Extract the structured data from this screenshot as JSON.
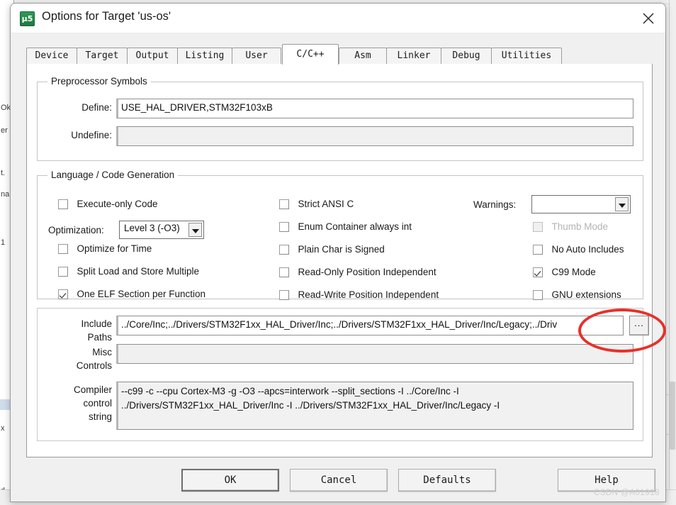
{
  "window": {
    "title": "Options for Target 'us-os'",
    "icon": "uvision-icon",
    "icon_glyph": "µ5",
    "close_label": "✕"
  },
  "tabs": [
    {
      "label": "Device",
      "active": false
    },
    {
      "label": "Target",
      "active": false
    },
    {
      "label": "Output",
      "active": false
    },
    {
      "label": "Listing",
      "active": false
    },
    {
      "label": "User",
      "active": false
    },
    {
      "label": "C/C++",
      "active": true
    },
    {
      "label": "Asm",
      "active": false
    },
    {
      "label": "Linker",
      "active": false
    },
    {
      "label": "Debug",
      "active": false
    },
    {
      "label": "Utilities",
      "active": false
    }
  ],
  "preprocessor": {
    "legend": "Preprocessor Symbols",
    "define_label": "Define:",
    "define_value": "USE_HAL_DRIVER,STM32F103xB",
    "undefine_label": "Undefine:",
    "undefine_value": ""
  },
  "language": {
    "legend": "Language / Code Generation",
    "optimization_label": "Optimization:",
    "optimization_value": "Level 3 (-O3)",
    "warnings_label": "Warnings:",
    "warnings_value": "",
    "column1": [
      {
        "label": "Execute-only Code",
        "checked": false,
        "disabled": false
      },
      {
        "label": "Optimize for Time",
        "checked": false,
        "disabled": false
      },
      {
        "label": "Split Load and Store Multiple",
        "checked": false,
        "disabled": false
      },
      {
        "label": "One ELF Section per Function",
        "checked": true,
        "disabled": false
      }
    ],
    "column2": [
      {
        "label": "Strict ANSI C",
        "checked": false,
        "disabled": false
      },
      {
        "label": "Enum Container always int",
        "checked": false,
        "disabled": false
      },
      {
        "label": "Plain Char is Signed",
        "checked": false,
        "disabled": false
      },
      {
        "label": "Read-Only Position Independent",
        "checked": false,
        "disabled": false
      },
      {
        "label": "Read-Write Position Independent",
        "checked": false,
        "disabled": false
      }
    ],
    "column3": [
      {
        "label": "Thumb Mode",
        "checked": false,
        "disabled": true
      },
      {
        "label": "No Auto Includes",
        "checked": false,
        "disabled": false
      },
      {
        "label": "C99 Mode",
        "checked": true,
        "disabled": false
      },
      {
        "label": "GNU extensions",
        "checked": false,
        "disabled": false
      }
    ]
  },
  "paths": {
    "include_label_line1": "Include",
    "include_label_line2": "Paths",
    "include_value": "../Core/Inc;../Drivers/STM32F1xx_HAL_Driver/Inc;../Drivers/STM32F1xx_HAL_Driver/Inc/Legacy;../Driv",
    "browse_label": "...",
    "misc_label_line1": "Misc",
    "misc_label_line2": "Controls",
    "misc_value": "",
    "compiler_label_line1": "Compiler",
    "compiler_label_line2": "control",
    "compiler_label_line3": "string",
    "compiler_value_line1": "--c99 -c --cpu Cortex-M3 -g -O3 --apcs=interwork --split_sections -I ../Core/Inc -I",
    "compiler_value_line2": "../Drivers/STM32F1xx_HAL_Driver/Inc -I ../Drivers/STM32F1xx_HAL_Driver/Inc/Legacy -I"
  },
  "footer": {
    "ok": "OK",
    "cancel": "Cancel",
    "defaults": "Defaults",
    "help": "Help"
  },
  "annotation": {
    "shape": "ellipse",
    "color": "#e8302a",
    "target": "include-paths-browse-button"
  },
  "watermark": "CSDN @A01918",
  "background": {
    "fragments": [
      "Ok",
      "er",
      "t.",
      "na",
      "1",
      "x",
      "d"
    ],
    "status_text": "·  · ··   ···   ··"
  }
}
